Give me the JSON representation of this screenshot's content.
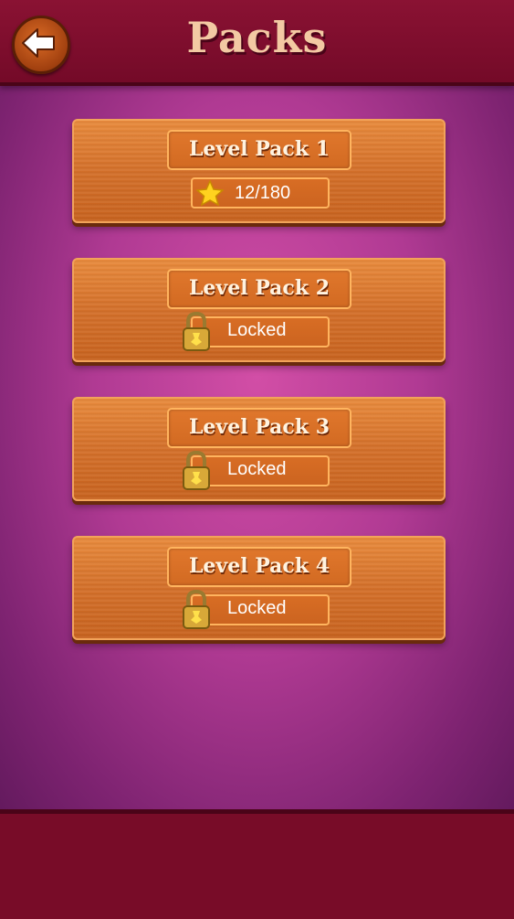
{
  "header": {
    "title": "Packs",
    "back_icon": "back-arrow-icon"
  },
  "packs": [
    {
      "label": "Level Pack 1",
      "status": "12/180",
      "icon": "star-icon",
      "locked": false
    },
    {
      "label": "Level Pack 2",
      "status": "Locked",
      "icon": "lock-icon",
      "locked": true
    },
    {
      "label": "Level Pack 3",
      "status": "Locked",
      "icon": "lock-icon",
      "locked": true
    },
    {
      "label": "Level Pack 4",
      "status": "Locked",
      "icon": "lock-icon",
      "locked": true
    }
  ],
  "colors": {
    "header": "#7a0d2a",
    "background": "#b03a93",
    "wood": "#d4702a",
    "title_text": "#f3c9a3"
  }
}
